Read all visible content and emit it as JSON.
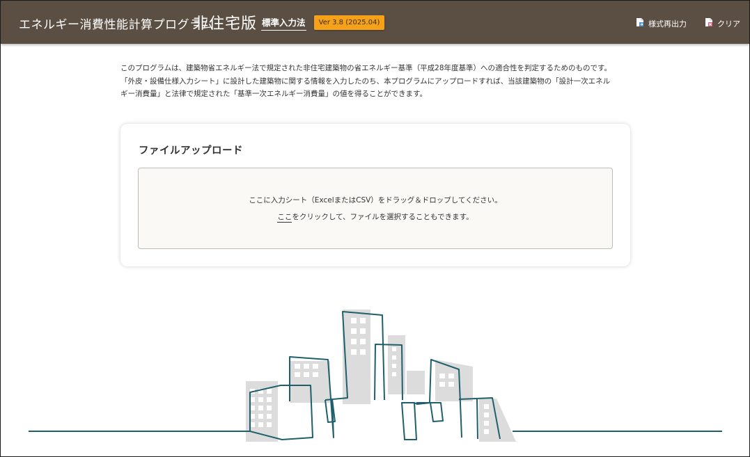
{
  "header": {
    "app_title": "エネルギー消費性能計算プログラム",
    "edition": "非住宅版",
    "mode": "標準入力法",
    "version": "Ver 3.8 (2025.04)",
    "reissue_label": "様式再出力",
    "reissue_icon": "document-export-icon",
    "clear_label": "クリア",
    "clear_icon": "document-clear-icon",
    "background_color": "#5b4f44",
    "version_color": "#f5a21a"
  },
  "description": {
    "line1": "このプログラムは、建築物省エネルギー法で規定された非住宅建築物の省エネルギー基準（平成28年度基準）への適合性を判定するためのものです。",
    "line2": "「外皮・設備仕様入力シート」に設計した建築物に関する情報を入力したのち、本プログラムにアップロードすれば、当該建築物の「設計一次エネル",
    "line3": "ギー消費量」と法律で規定された「基準一次エネルギー消費量」の値を得ることができます。"
  },
  "upload": {
    "title": "ファイルアップロード",
    "drop_text": "ここに入力シート（ExcelまたはCSV）をドラッグ＆ドロップしてください。",
    "link_text": "ここ",
    "link_suffix": "をクリックして、ファイルを選択することもできます。"
  },
  "illustration": {
    "name": "city-skyline-illustration",
    "line_color": "#1f5f6b",
    "building_color": "#dcdcdc"
  }
}
